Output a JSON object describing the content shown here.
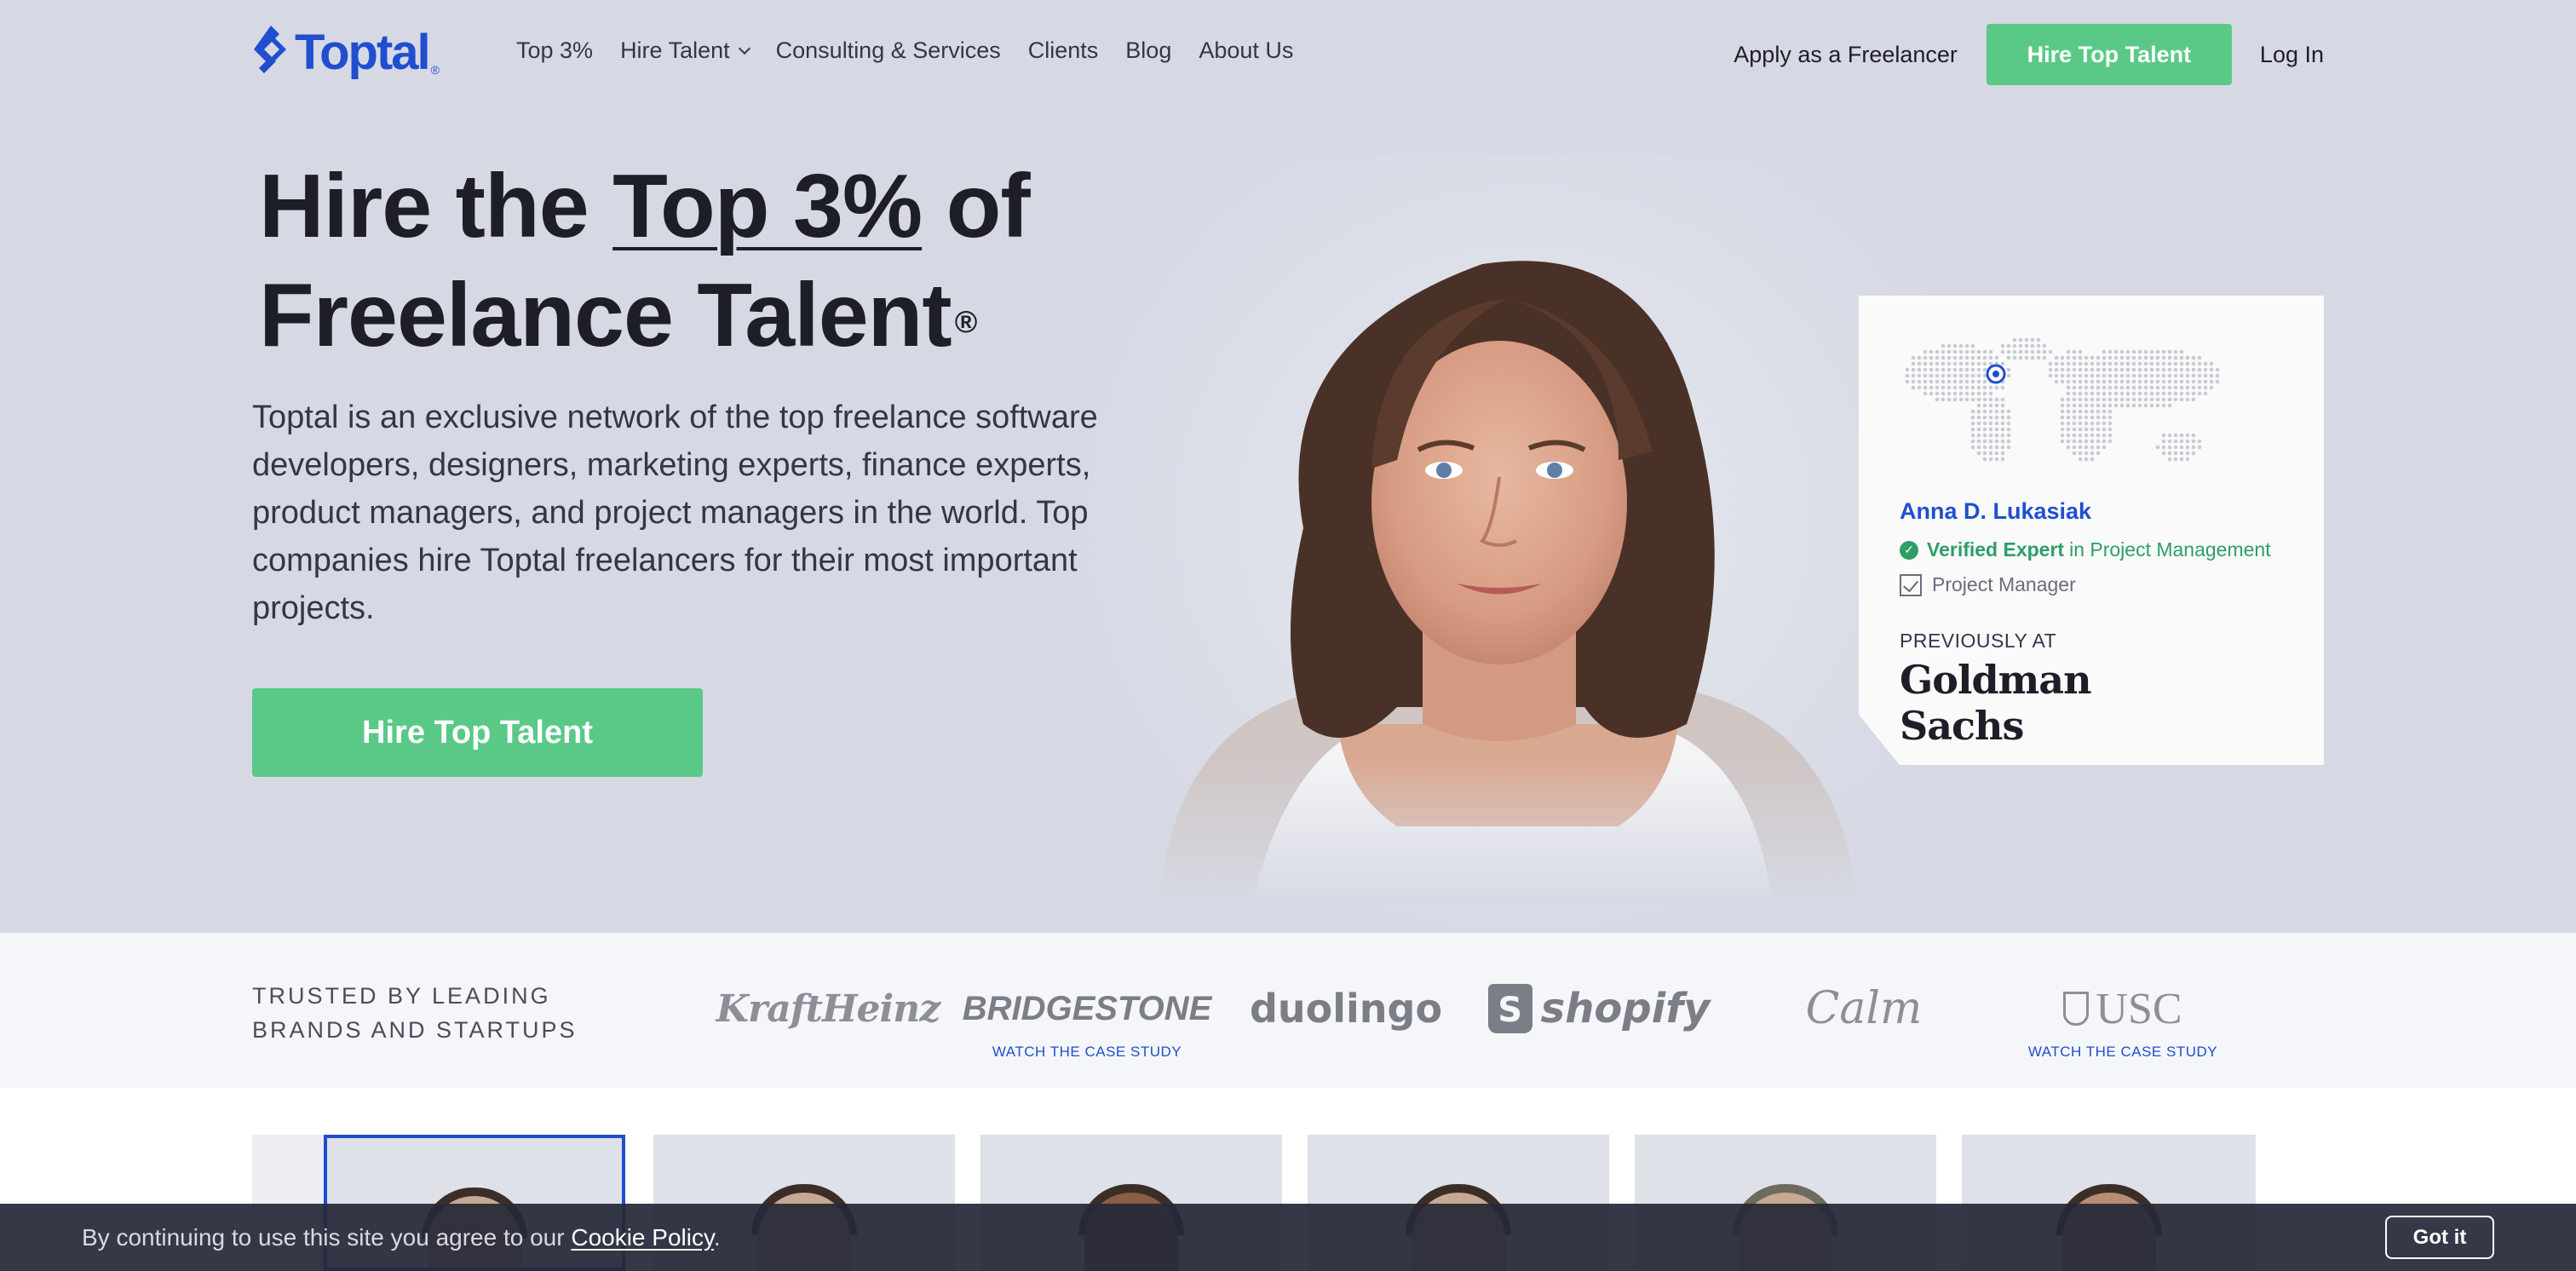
{
  "colors": {
    "brand_blue": "#204ecf",
    "accent_green": "#5ac987",
    "hero_bg": "#d6d9e4",
    "verified_green": "#2e9e66",
    "cookie_bg": "#262938"
  },
  "nav": {
    "logo_text": "Toptal",
    "logo_reg": "®",
    "links": [
      {
        "label": "Top 3%"
      },
      {
        "label": "Hire Talent",
        "has_dropdown": true
      },
      {
        "label": "Consulting & Services"
      },
      {
        "label": "Clients"
      },
      {
        "label": "Blog"
      },
      {
        "label": "About Us"
      }
    ],
    "apply_label": "Apply as a Freelancer",
    "hire_label": "Hire Top Talent",
    "login_label": "Log In"
  },
  "hero": {
    "headline_pre": "Hire the ",
    "headline_highlight": "Top 3%",
    "headline_post": " of",
    "headline_line2": "Freelance Talent",
    "headline_reg": "®",
    "intro": "Toptal is an exclusive network of the top freelance software developers, designers, marketing experts, finance experts, product managers, and project managers in the world. Top companies hire Toptal freelancers for their most important projects.",
    "cta_label": "Hire Top Talent"
  },
  "profile_card": {
    "name": "Anna D. Lukasiak",
    "verified_bold": "Verified Expert",
    "verified_rest": "in Project Management",
    "role": "Project Manager",
    "previously_label": "PREVIOUSLY AT",
    "company": "Goldman Sachs"
  },
  "trusted": {
    "label": "TRUSTED BY LEADING BRANDS AND STARTUPS",
    "brands": [
      {
        "name": "KraftHeinz",
        "case_study": ""
      },
      {
        "name": "BRIDGESTONE",
        "case_study": "WATCH THE CASE STUDY"
      },
      {
        "name": "duolingo",
        "case_study": ""
      },
      {
        "name": "shopify",
        "case_study": ""
      },
      {
        "name": "Calm",
        "case_study": ""
      },
      {
        "name": "USC",
        "case_study": "WATCH THE CASE STUDY"
      }
    ]
  },
  "cookie": {
    "text": "By continuing to use this site you agree to our ",
    "link": "Cookie Policy",
    "suffix": ".",
    "button": "Got it"
  }
}
